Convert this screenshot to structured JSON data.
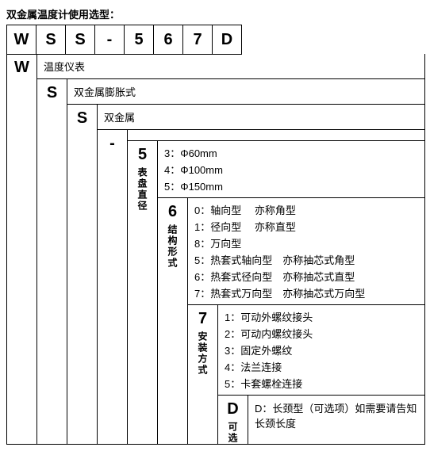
{
  "title": "双金属温度计使用选型：",
  "code": [
    "W",
    "S",
    "S",
    "-",
    "5",
    "6",
    "7",
    "D"
  ],
  "w": {
    "key": "W",
    "label": "温度仪表",
    "s1": {
      "key": "S",
      "label": "双金属膨胀式",
      "s2": {
        "key": "S",
        "label": "双金属",
        "dash": {
          "key": "-",
          "label": "",
          "p5": {
            "key": "5",
            "sub": "表盘直径",
            "opts": [
              "3：Φ60mm",
              "4：Φ100mm",
              "5：Φ150mm"
            ],
            "p6": {
              "key": "6",
              "sub": "结构形式",
              "opts": [
                "0：轴向型　 亦称角型",
                "1：径向型　 亦称直型",
                "8：万向型",
                "5：热套式轴向型　亦称抽芯式角型",
                "6：热套式径向型　亦称抽芯式直型",
                "7：热套式万向型　亦称抽芯式万向型"
              ],
              "p7": {
                "key": "7",
                "sub": "安装方式",
                "opts": [
                  "1：可动外螺纹接头",
                  "2：可动内螺纹接头",
                  "3：固定外螺纹",
                  "4：法兰连接",
                  "5：卡套螺栓连接"
                ],
                "pd": {
                  "key": "D",
                  "sub": "可选",
                  "label": "D：长颈型（可选项）如需要请告知长颈长度"
                }
              }
            }
          }
        }
      }
    }
  }
}
